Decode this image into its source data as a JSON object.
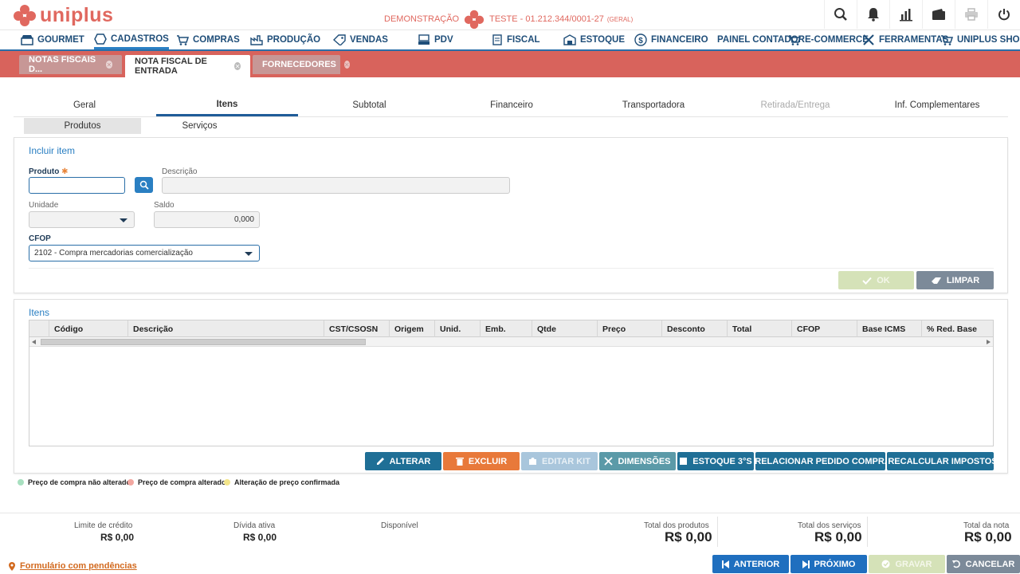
{
  "app": {
    "brand": "uniplus"
  },
  "header": {
    "mode": "DEMONSTRAÇÃO",
    "company": "TESTE - 01.212.344/0001-27",
    "scope": "(GERAL)",
    "icons": [
      "search-icon",
      "bell-icon",
      "chart-icon",
      "wallet-icon",
      "printer-icon",
      "power-icon"
    ]
  },
  "menu": [
    {
      "label": "GOURMET",
      "icon": "store-icon"
    },
    {
      "label": "CADASTROS",
      "icon": "hexagon-icon",
      "active": true
    },
    {
      "label": "COMPRAS",
      "icon": "cart-icon"
    },
    {
      "label": "PRODUÇÃO",
      "icon": "factory-icon"
    },
    {
      "label": "VENDAS",
      "icon": "tag-icon"
    },
    {
      "label": "PDV",
      "icon": "pos-icon"
    },
    {
      "label": "FISCAL",
      "icon": "document-icon"
    },
    {
      "label": "ESTOQUE",
      "icon": "warehouse-icon"
    },
    {
      "label": "FINANCEIRO",
      "icon": "dollar-icon"
    },
    {
      "label": "PAINEL CONTADOR",
      "icon": ""
    },
    {
      "label": "E-COMMERCE",
      "icon": "cart-icon"
    },
    {
      "label": "FERRAMENTAS",
      "icon": "tools-icon"
    },
    {
      "label": "UNIPLUS SHOP",
      "icon": "cart-icon"
    }
  ],
  "doc_tabs": [
    {
      "label": "NOTAS FISCAIS D...",
      "active": false
    },
    {
      "label": "NOTA FISCAL DE ENTRADA",
      "active": true
    },
    {
      "label": "FORNECEDORES",
      "active": false
    }
  ],
  "section_tabs": [
    {
      "label": "Geral"
    },
    {
      "label": "Itens",
      "active": true
    },
    {
      "label": "Subtotal"
    },
    {
      "label": "Financeiro"
    },
    {
      "label": "Transportadora"
    },
    {
      "label": "Retirada/Entrega",
      "disabled": true
    },
    {
      "label": "Inf. Complementares"
    }
  ],
  "sub_tabs": [
    {
      "label": "Produtos",
      "active": true
    },
    {
      "label": "Serviços"
    }
  ],
  "include_item": {
    "title": "Incluir item",
    "produto_label": "Produto",
    "required_mark": "✱",
    "produto_value": "",
    "descricao_label": "Descrição",
    "descricao_value": "",
    "unidade_label": "Unidade",
    "unidade_value": "",
    "saldo_label": "Saldo",
    "saldo_value": "0,000",
    "cfop_label": "CFOP",
    "cfop_value": "2102 - Compra mercadorias comercialização",
    "ok_label": "OK",
    "limpar_label": "LIMPAR"
  },
  "items": {
    "title": "Itens",
    "columns": [
      "Código",
      "Descrição",
      "CST/CSOSN",
      "Origem",
      "Unid.",
      "Emb.",
      "Qtde",
      "Preço",
      "Desconto",
      "Total",
      "CFOP",
      "Base ICMS",
      "% Red. Base"
    ],
    "rows": []
  },
  "actions": {
    "alterar": "ALTERAR",
    "excluir": "EXCLUIR",
    "editar_kit": "EDITAR KIT",
    "dimensoes": "DIMENSÕES",
    "estoque3": "ESTOQUE 3°S",
    "relacionar": "RELACIONAR PEDIDO COMPRA",
    "recalcular": "RECALCULAR IMPOSTOS"
  },
  "legend": [
    {
      "label": "Preço de compra não alterado",
      "color": "#a8e0c0"
    },
    {
      "label": "Preço de compra alterado",
      "color": "#f2a7a0"
    },
    {
      "label": "Alteração de preço confirmada",
      "color": "#f3e58a"
    }
  ],
  "footer": {
    "limite_label": "Limite de crédito",
    "limite_value": "R$ 0,00",
    "divida_label": "Dívida ativa",
    "divida_value": "R$ 0,00",
    "disponivel_label": "Disponível",
    "disponivel_value": "",
    "total_produtos_label": "Total dos produtos",
    "total_produtos_value": "R$ 0,00",
    "total_servicos_label": "Total dos serviços",
    "total_servicos_value": "R$ 0,00",
    "total_nota_label": "Total da nota",
    "total_nota_value": "R$ 0,00",
    "pendencias": "Formulário com pendências",
    "anterior": "ANTERIOR",
    "proximo": "PRÓXIMO",
    "gravar": "GRAVAR",
    "cancelar": "CANCELAR"
  },
  "colors": {
    "brand": "#e0685f",
    "primary": "#1f6f96",
    "accent": "#2a7fc2",
    "tabstrip": "#d8635c",
    "excluir": "#e8793a"
  }
}
